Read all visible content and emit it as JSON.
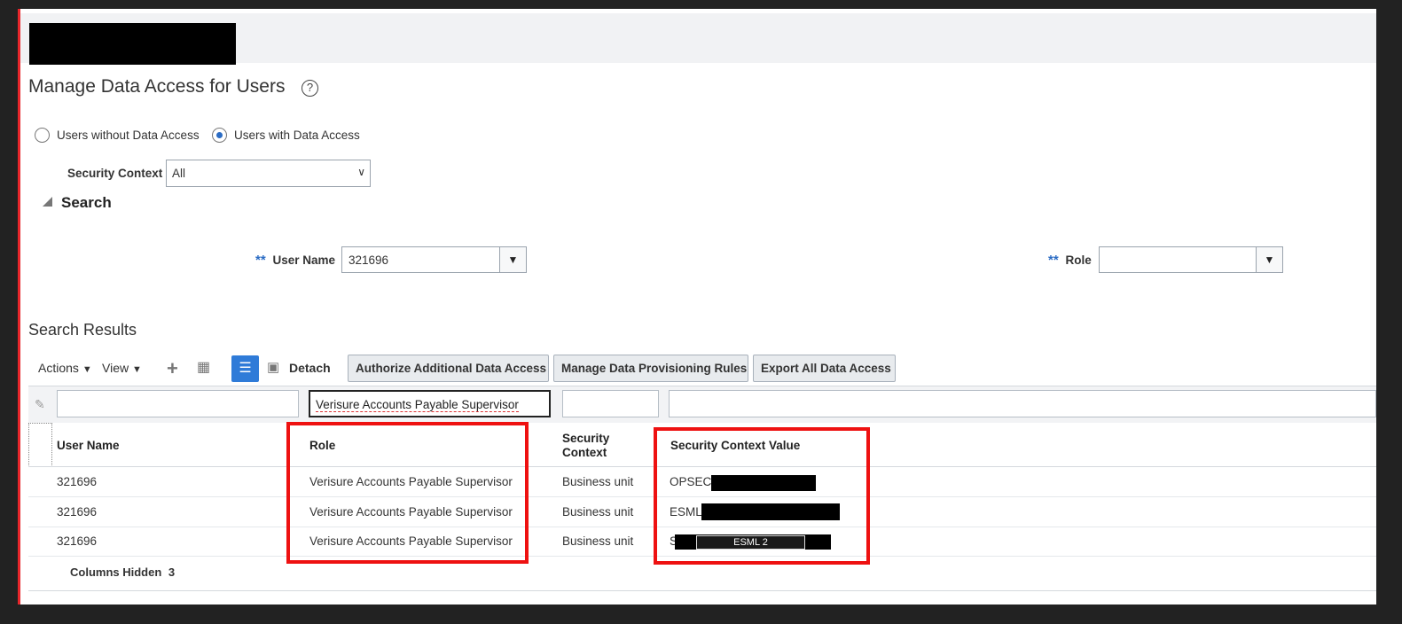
{
  "page": {
    "title": "Manage Data Access for Users",
    "help_icon": "?"
  },
  "filters": {
    "radio_without": "Users without Data Access",
    "radio_with": "Users with Data Access",
    "selected_radio": "Users with Data Access",
    "security_context_label": "Security Context",
    "security_context_value": "All"
  },
  "search": {
    "header": "Search",
    "required_marker": "**",
    "user_name_label": "User Name",
    "user_name_value": "321696",
    "role_label": "Role",
    "role_value": ""
  },
  "results": {
    "title": "Search Results",
    "toolbar": {
      "actions": "Actions",
      "view": "View",
      "detach": "Detach",
      "authorize": "Authorize Additional Data Access",
      "manage_rules": "Manage Data Provisioning Rules",
      "export": "Export All Data Access"
    },
    "filter_values": {
      "user_name": "",
      "role": "Verisure Accounts Payable Supervisor",
      "security_context": "",
      "security_context_value": ""
    },
    "columns": {
      "user_name": "User Name",
      "role": "Role",
      "security_context_line1": "Security",
      "security_context_line2": "Context",
      "security_context_value": "Security Context Value"
    },
    "rows": [
      {
        "user_name": "321696",
        "role": "Verisure Accounts Payable Supervisor",
        "security_context": "Business unit",
        "value_prefix": "OPSEC"
      },
      {
        "user_name": "321696",
        "role": "Verisure Accounts Payable Supervisor",
        "security_context": "Business unit",
        "value_prefix": "ESML"
      },
      {
        "user_name": "321696",
        "role": "Verisure Accounts Payable Supervisor",
        "security_context": "Business unit",
        "value_prefix": "S",
        "tag": "ESML 2"
      }
    ],
    "columns_hidden_label": "Columns Hidden",
    "columns_hidden_count": "3"
  },
  "colors": {
    "accent_blue": "#2f7bd8",
    "highlight_red": "#ee1111",
    "left_edge_red": "#e8262b"
  }
}
